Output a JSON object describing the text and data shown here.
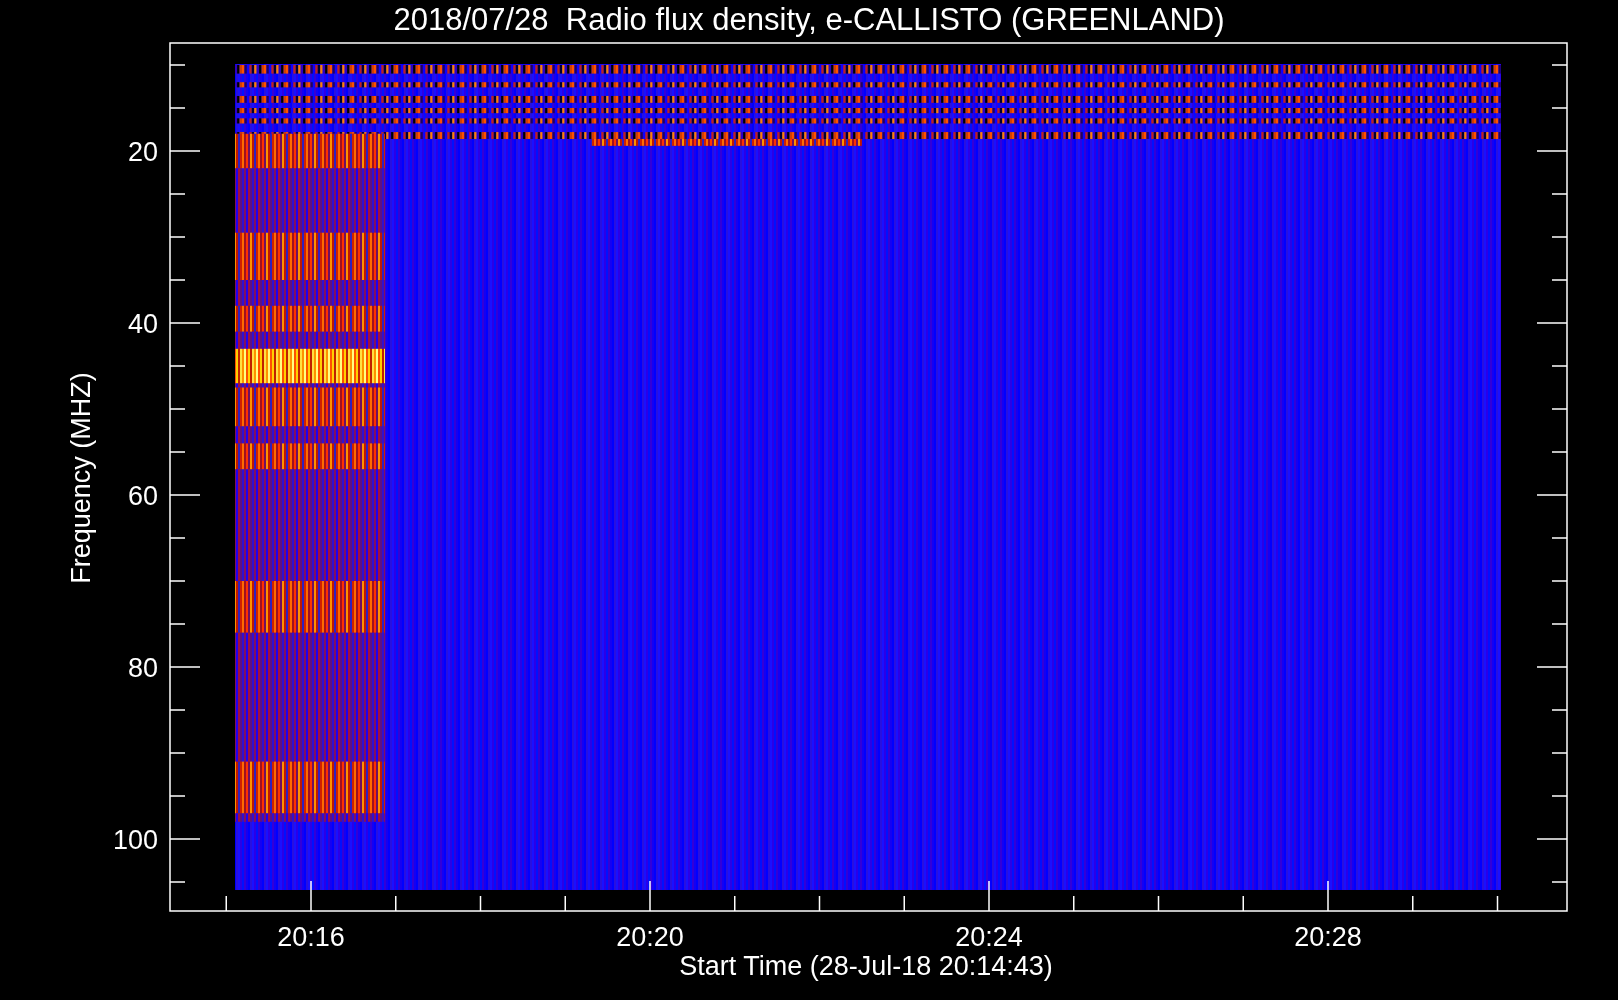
{
  "title": "2018/07/28  Radio flux density, e-CALLISTO (GREENLAND)",
  "plot": {
    "xlabel": "Start Time (28-Jul-18 20:14:43)",
    "ylabel": "Frequency (MHZ)",
    "xticks": [
      "20:16",
      "20:20",
      "20:24",
      "20:28"
    ],
    "yticks": [
      "20",
      "40",
      "60",
      "80",
      "100"
    ]
  }
}
